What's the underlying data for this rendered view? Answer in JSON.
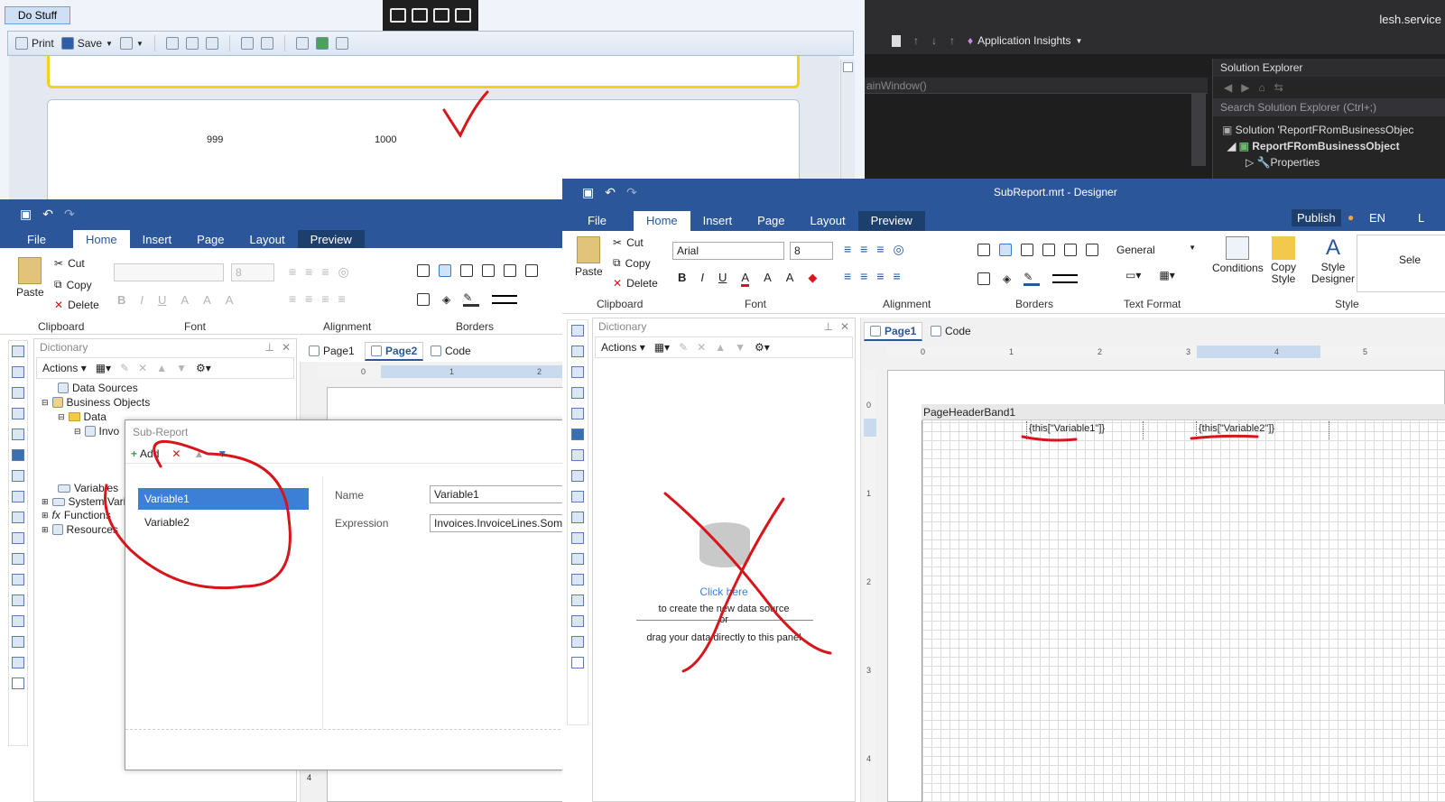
{
  "background_window": {
    "do_stuff_button": "Do Stuff",
    "toolbar": {
      "print_label": "Print",
      "save_label": "Save"
    },
    "page_values": [
      "999",
      "1000"
    ]
  },
  "visual_studio": {
    "application_insights": "Application Insights",
    "user_label": "lesh.service",
    "editor_text": "ainWindow()",
    "solution_explorer": {
      "title": "Solution Explorer",
      "search_placeholder": "Search Solution Explorer (Ctrl+;)",
      "solution_label": "Solution 'ReportFRomBusinessObjec",
      "project_label": "ReportFRomBusinessObject",
      "properties_label": "Properties"
    }
  },
  "left_designer": {
    "tabs": [
      "File",
      "Home",
      "Insert",
      "Page",
      "Layout",
      "Preview"
    ],
    "clipboard": {
      "paste": "Paste",
      "cut": "Cut",
      "copy": "Copy",
      "delete": "Delete",
      "group": "Clipboard"
    },
    "font_group": "Font",
    "font_size": "8",
    "alignment_group": "Alignment",
    "borders_group": "Borders",
    "dictionary": {
      "title": "Dictionary",
      "actions": "Actions",
      "tree": {
        "data_sources": "Data Sources",
        "business_objects": "Business Objects",
        "data": "Data",
        "invoices": "Invo",
        "variables": "Variables",
        "system_variables": "System Varia",
        "functions": "Functions",
        "resources": "Resources"
      }
    },
    "doc_tabs": [
      "Page1",
      "Page2",
      "Code"
    ],
    "ruler_marks": [
      "0",
      "1",
      "2"
    ],
    "side_ruler_mark": "4"
  },
  "subreport_dialog": {
    "title": "Sub-Report",
    "add": "Add",
    "variables": [
      "Variable1",
      "Variable2"
    ],
    "name_label": "Name",
    "name_value": "Variable1",
    "expression_label": "Expression",
    "expression_value": "Invoices.InvoiceLines.SomeKe"
  },
  "right_designer": {
    "title": "SubReport.mrt - Designer",
    "tabs": [
      "File",
      "Home",
      "Insert",
      "Page",
      "Layout",
      "Preview"
    ],
    "publish": "Publish",
    "language": "EN",
    "extra_tab": "L",
    "clipboard": {
      "paste": "Paste",
      "cut": "Cut",
      "copy": "Copy",
      "delete": "Delete",
      "group": "Clipboard"
    },
    "font_name": "Arial",
    "font_size": "8",
    "font_group": "Font",
    "alignment_group": "Alignment",
    "borders_group": "Borders",
    "text_format": {
      "value": "General",
      "group": "Text Format"
    },
    "style": {
      "conditions": "Conditions",
      "copy_style": "Copy Style",
      "style_designer": "Style Designer",
      "group": "Style",
      "select": "Sele"
    },
    "dictionary": {
      "title": "Dictionary",
      "actions": "Actions",
      "click_here": "Click here",
      "create_text": "to create the new data source",
      "or_text": "or",
      "drag_text": "drag your data directly to this panel"
    },
    "doc_tabs": [
      "Page1",
      "Code"
    ],
    "ruler_marks": [
      "0",
      "1",
      "2",
      "3",
      "4",
      "5"
    ],
    "side_ruler_marks": [
      "0",
      "1",
      "2",
      "3",
      "4"
    ],
    "band_title": "PageHeaderBand1",
    "field1": "{this[\"Variable1\"]}",
    "field2": "{this[\"Variable2\"]}"
  },
  "colors": {
    "ribbon_blue": "#2b579a",
    "annotation_red": "#d7161c",
    "selected_item": "#3d7fd6",
    "vs_dark": "#1e1e1e"
  }
}
